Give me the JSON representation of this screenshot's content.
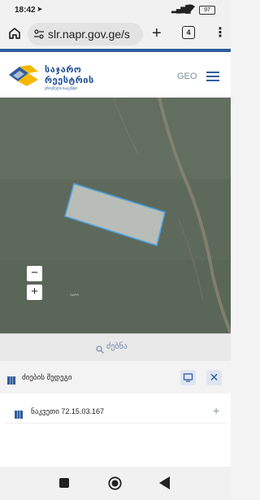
{
  "status_bar": {
    "time": "18:42",
    "nav_icon": "navigation-arrow",
    "battery": "97"
  },
  "browser": {
    "url": "slr.napr.gov.ge/s",
    "tab_count": "4",
    "new_tab": "+",
    "menu": "⋮"
  },
  "header": {
    "logo_line1": "საჯარო",
    "logo_line2": "რეესტრის",
    "logo_line3": "ეროვნული სააგენტო",
    "language": "GEO"
  },
  "map": {
    "zoom_out": "−",
    "zoom_in": "+",
    "watermark": "NAPR",
    "parcel_color": "#4aa3df"
  },
  "search": {
    "label": "ძებნა"
  },
  "results": {
    "title": "ძიების შედეგი",
    "close": "✕",
    "items": [
      {
        "label": "ნაკვეთი 72.15.03.167",
        "expand": "+"
      }
    ]
  },
  "colors": {
    "brand_blue": "#2f5d9e",
    "brand_yellow": "#f5b800"
  }
}
